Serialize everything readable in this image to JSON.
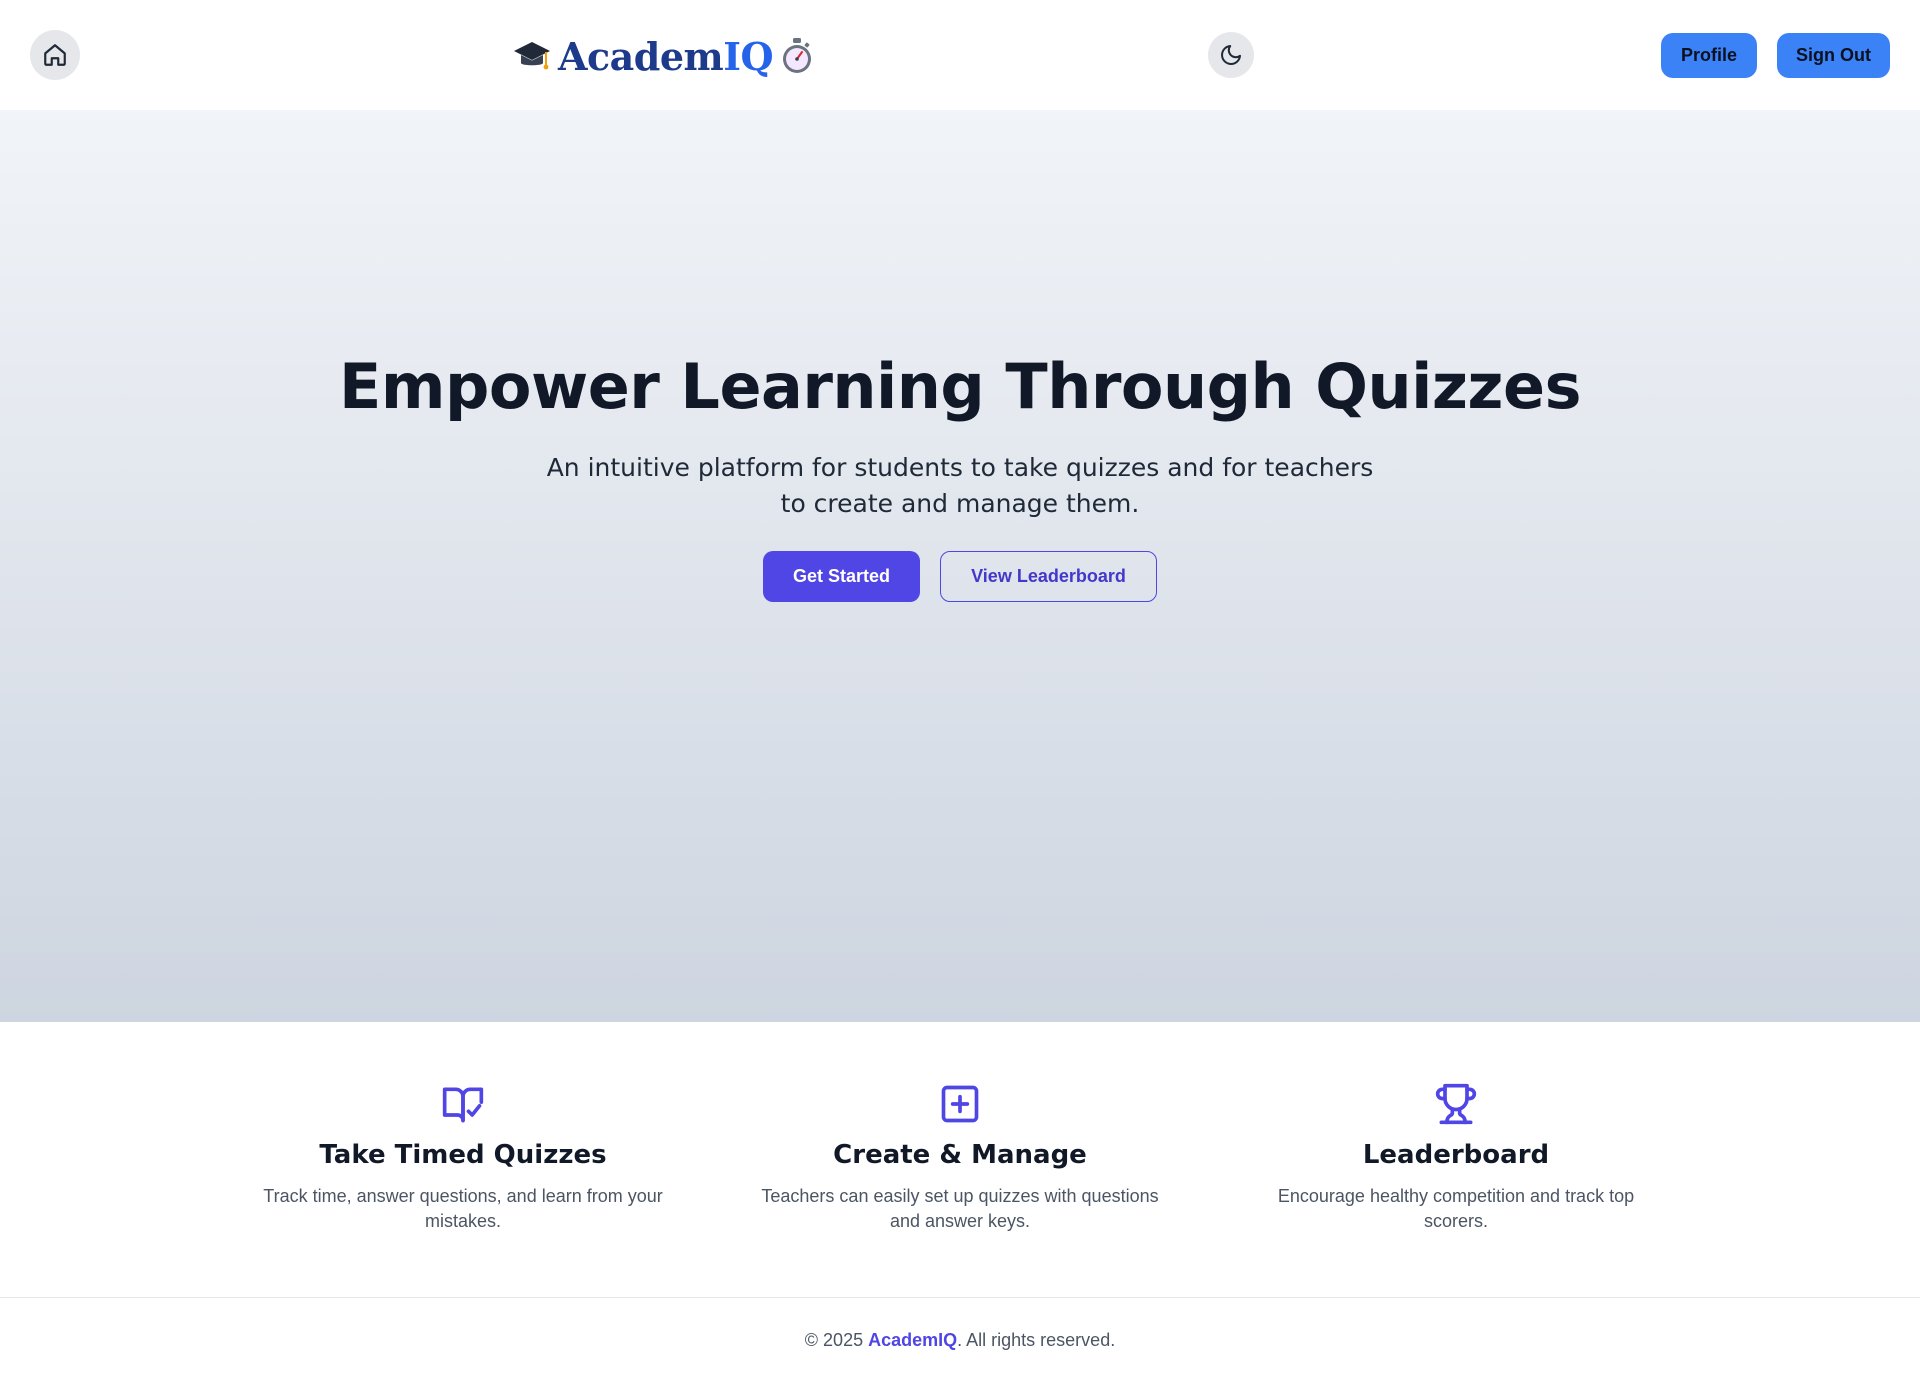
{
  "header": {
    "logo_part1": "Academ",
    "logo_part2": "IQ",
    "profile_label": "Profile",
    "signout_label": "Sign Out"
  },
  "hero": {
    "title": "Empower Learning Through Quizzes",
    "subtitle": "An intuitive platform for students to take quizzes and for teachers to create and manage them.",
    "get_started_label": "Get Started",
    "leaderboard_label": "View Leaderboard"
  },
  "features": [
    {
      "icon": "book-check-icon",
      "title": "Take Timed Quizzes",
      "description": "Track time, answer questions, and learn from your mistakes."
    },
    {
      "icon": "plus-square-icon",
      "title": "Create & Manage",
      "description": "Teachers can easily set up quizzes with questions and answer keys."
    },
    {
      "icon": "trophy-icon",
      "title": "Leaderboard",
      "description": "Encourage healthy competition and track top scorers."
    }
  ],
  "footer": {
    "prefix": "© 2025 ",
    "brand": "AcademIQ",
    "suffix": ". All rights reserved."
  },
  "colors": {
    "primary": "#4f46e5",
    "header_button": "#3b82f6",
    "logo_dark": "#1e3a8a",
    "logo_light": "#2563eb"
  }
}
